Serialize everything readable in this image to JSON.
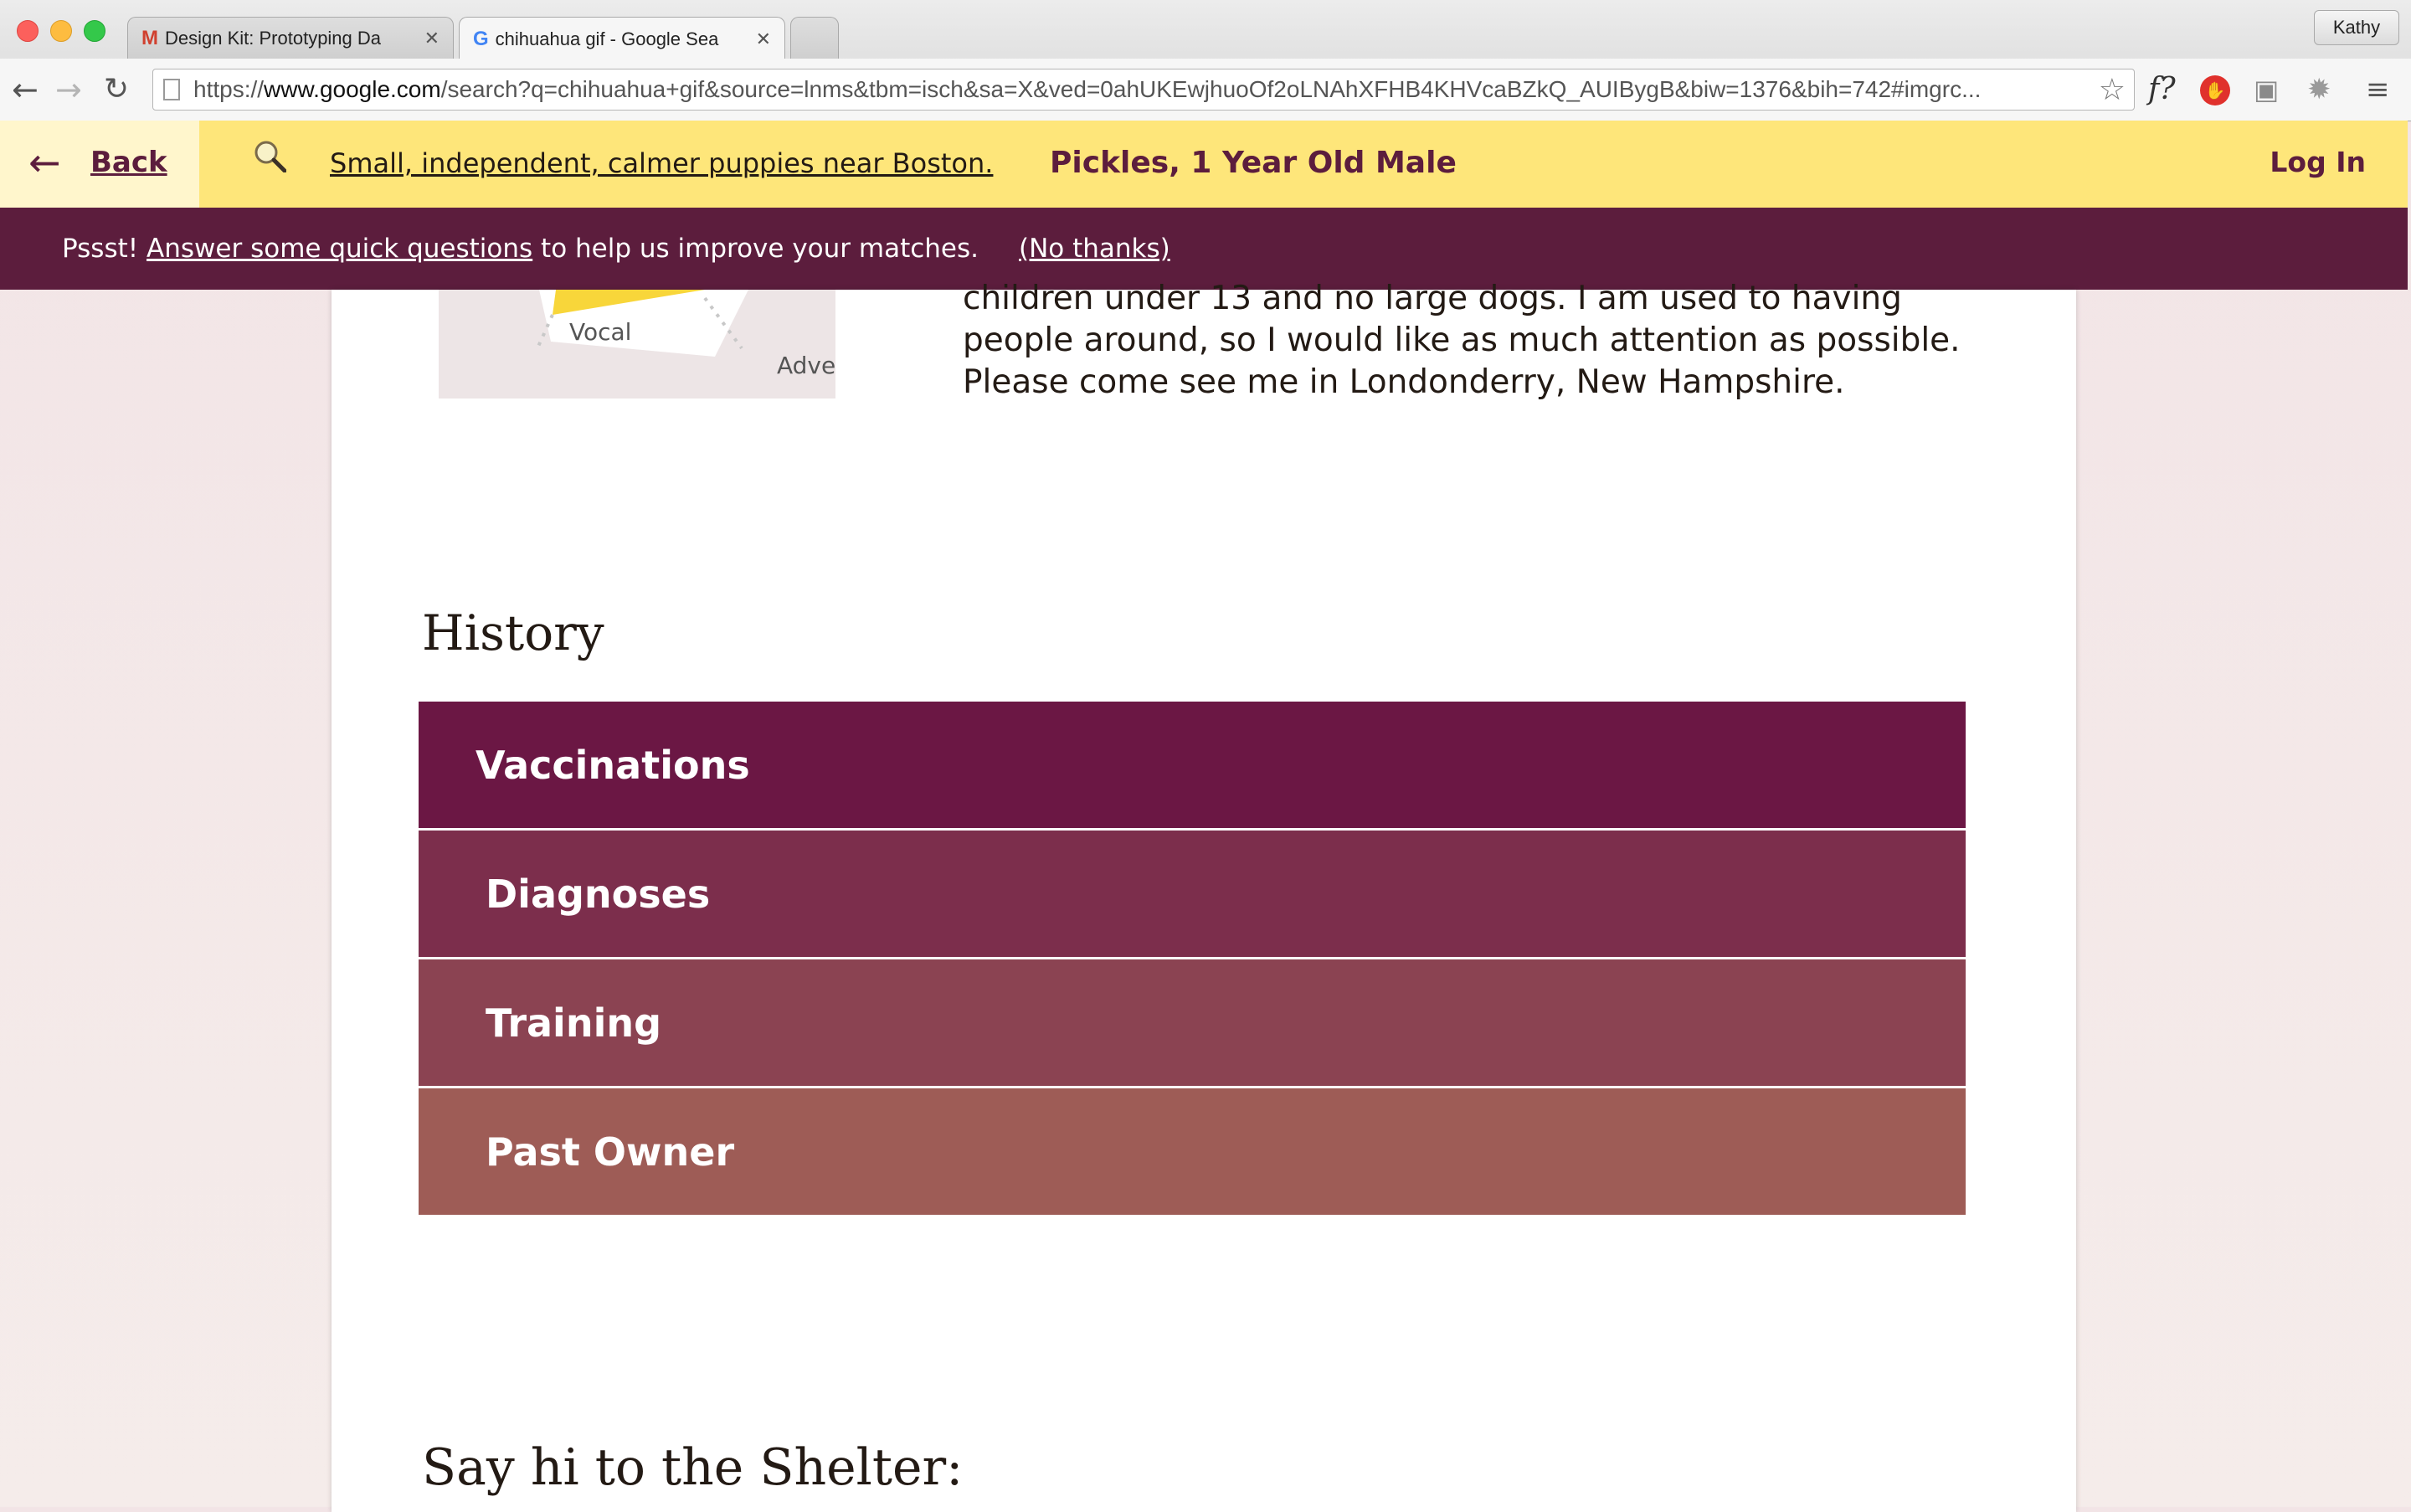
{
  "browser": {
    "tabs": [
      {
        "favicon": "gmail-icon",
        "glyph": "M",
        "color": "#d0402f",
        "title": "Design Kit: Prototyping Da"
      },
      {
        "favicon": "google-icon",
        "glyph": "G",
        "color": "#4285f4",
        "title": "chihuahua gif - Google Sea"
      }
    ],
    "profile_name": "Kathy",
    "url_prefix": "https://",
    "url_host": "www.google.com",
    "url_rest": "/search?q=chihuahua+gif&source=lnms&tbm=isch&sa=X&ved=0ahUKEwjhuoOf2oLNAhXFHB4KHVcaBZkQ_AUIBygB&biw=1376&bih=742#imgrc...",
    "extension_f_label": "f?"
  },
  "header": {
    "back_label": "Back",
    "search_summary": "Small, independent, calmer puppies near Boston.",
    "dog_title": "Pickles, 1 Year Old Male",
    "login_label": "Log In",
    "colors": {
      "bar": "#fee67a",
      "back_area": "#fff6cc",
      "accent": "#5c1d3d"
    }
  },
  "notice": {
    "prefix": "Pssst! ",
    "link": "Answer some quick questions",
    "suffix": " to help us improve your matches.",
    "dismiss": "(No thanks)"
  },
  "profile": {
    "traits": [
      "Vocal",
      "Adventurous"
    ],
    "description": "children under 13 and no large dogs. I am used to having people around, so I would like as much attention as possible. Please come see me in Londonderry, New Hampshire."
  },
  "history": {
    "heading": "History",
    "items": [
      {
        "label": "Vaccinations",
        "color": "#6b1744"
      },
      {
        "label": "Diagnoses",
        "color": "#7c2e4c"
      },
      {
        "label": "Training",
        "color": "#8b4352"
      },
      {
        "label": "Past Owner",
        "color": "#9e5c56"
      }
    ]
  },
  "shelter": {
    "heading": "Say hi to the Shelter:"
  }
}
